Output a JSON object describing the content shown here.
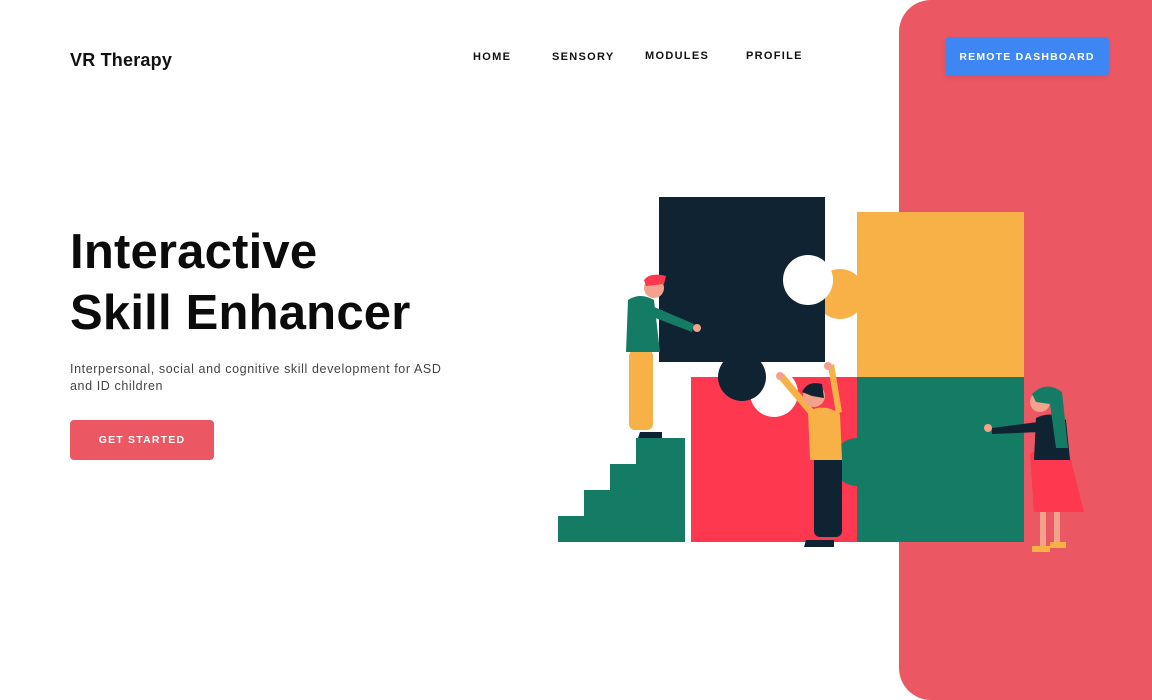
{
  "brand": {
    "name": "VR Therapy"
  },
  "nav": {
    "items": [
      {
        "label": "HOME"
      },
      {
        "label": "SENSORY"
      },
      {
        "label": "MODULES"
      },
      {
        "label": "PROFILE"
      }
    ],
    "dashboard_label": "REMOTE DASHBOARD"
  },
  "hero": {
    "title_line1": "Interactive",
    "title_line2": "Skill Enhancer",
    "subtitle": "Interpersonal, social and cognitive skill development for ASD and ID children",
    "cta_label": "GET STARTED"
  },
  "colors": {
    "accent_red": "#eb5864",
    "accent_blue": "#3f86f5",
    "puzzle_navy": "#102332",
    "puzzle_yellow": "#f8b146",
    "puzzle_green": "#147b64",
    "puzzle_red": "#fd384f"
  },
  "illustration": {
    "icon": "puzzle-team-illustration"
  }
}
